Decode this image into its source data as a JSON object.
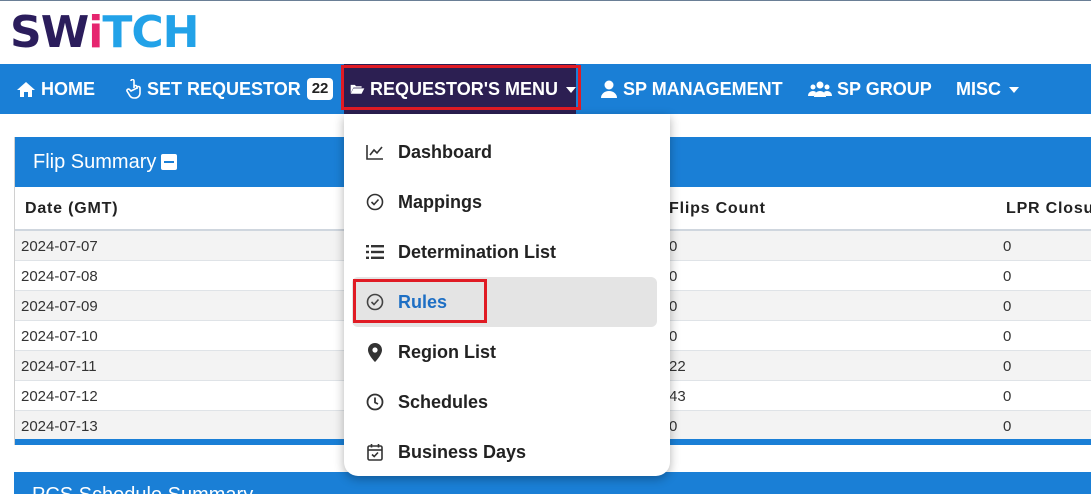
{
  "logo": {
    "part1": "SW",
    "part2": "i",
    "part3": "TCH"
  },
  "nav": {
    "home": "HOME",
    "set_requestor": "SET REQUESTOR",
    "requestor_count": "22",
    "requestors_menu": "REQUESTOR'S MENU",
    "sp_management": "SP MANAGEMENT",
    "sp_group": "SP GROUP",
    "misc": "MISC"
  },
  "dropdown": {
    "items": [
      {
        "label": "Dashboard",
        "icon": "chart-line-icon"
      },
      {
        "label": "Mappings",
        "icon": "check-circle-icon"
      },
      {
        "label": "Determination List",
        "icon": "list-icon"
      },
      {
        "label": "Rules",
        "icon": "check-circle-icon",
        "active": true
      },
      {
        "label": "Region List",
        "icon": "map-pin-icon"
      },
      {
        "label": "Schedules",
        "icon": "clock-icon"
      },
      {
        "label": "Business Days",
        "icon": "calendar-check-icon"
      }
    ]
  },
  "flip_summary": {
    "title": "Flip Summary",
    "columns": [
      "Date (GMT)",
      "Flips Count",
      "LPR Closur"
    ],
    "rows": [
      [
        "2024-07-07",
        "0",
        "0"
      ],
      [
        "2024-07-08",
        "0",
        "0"
      ],
      [
        "2024-07-09",
        "0",
        "0"
      ],
      [
        "2024-07-10",
        "0",
        "0"
      ],
      [
        "2024-07-11",
        "22",
        "0"
      ],
      [
        "2024-07-12",
        "43",
        "0"
      ],
      [
        "2024-07-13",
        "0",
        "0"
      ]
    ]
  },
  "second_panel": {
    "title": "PCS Schedule Summary"
  },
  "colors": {
    "nav_blue": "#1a7fd6",
    "active_nav": "#2c1f52",
    "highlight_red": "#e01b24",
    "link_blue": "#1e6fc4"
  }
}
